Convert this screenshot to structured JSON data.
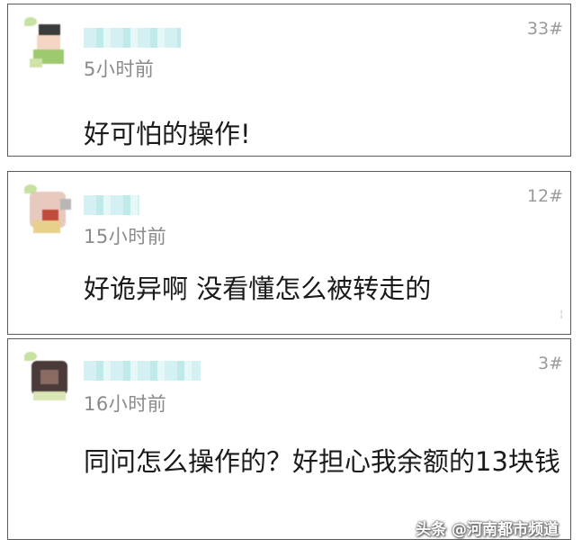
{
  "comments": [
    {
      "floor": "33#",
      "time": "5小时前",
      "text": "好可怕的操作!"
    },
    {
      "floor": "12#",
      "time": "15小时前",
      "text": "好诡异啊 没看懂怎么被转走的"
    },
    {
      "floor": "3#",
      "time": "16小时前",
      "text": "同问怎么操作的？好担心我余额的13块钱"
    }
  ],
  "watermark": "头条 @河南都市频道",
  "colors": {
    "border": "#5a5a5a",
    "username_blur": "#bfeaea",
    "time": "#8a8a8a",
    "text": "#1a1a1a"
  }
}
